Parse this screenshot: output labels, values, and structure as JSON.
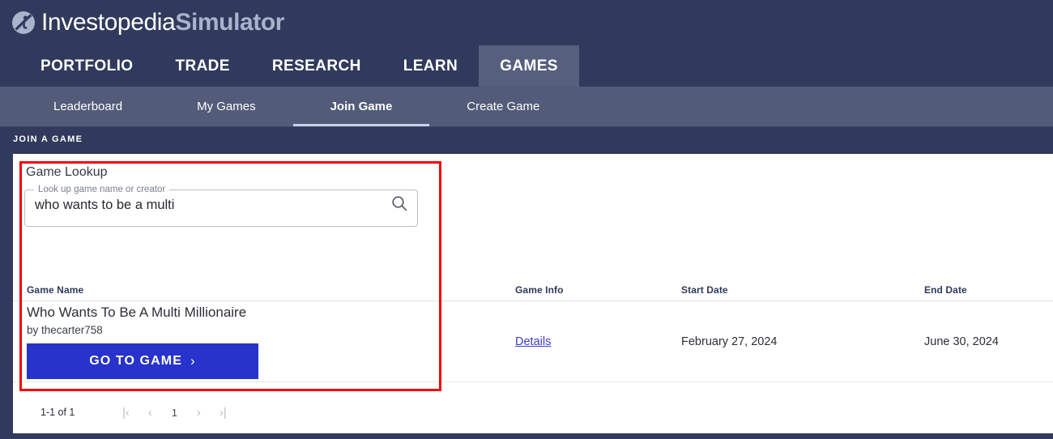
{
  "brand": {
    "logo_icon": "investopedia-circle-i-icon",
    "name_part1": "Investopedia",
    "name_part2": "Simulator"
  },
  "main_nav": {
    "items": [
      {
        "label": "PORTFOLIO",
        "active": false
      },
      {
        "label": "TRADE",
        "active": false
      },
      {
        "label": "RESEARCH",
        "active": false
      },
      {
        "label": "LEARN",
        "active": false
      },
      {
        "label": "GAMES",
        "active": true
      }
    ]
  },
  "sub_nav": {
    "items": [
      {
        "label": "Leaderboard",
        "active": false
      },
      {
        "label": "My Games",
        "active": false
      },
      {
        "label": "Join Game",
        "active": true
      },
      {
        "label": "Create Game",
        "active": false
      }
    ]
  },
  "section": {
    "title": "JOIN A GAME"
  },
  "lookup": {
    "card_heading": "Game Lookup",
    "field_legend": "Look up game name or creator",
    "input_value": "who wants to be a multi",
    "input_placeholder": "Look up game name or creator",
    "search_icon": "search-icon"
  },
  "table": {
    "headers": {
      "game_name": "Game Name",
      "game_info": "Game Info",
      "start_date": "Start Date",
      "end_date": "End Date"
    },
    "rows": [
      {
        "game_name": "Who Wants To Be A Multi Millionaire",
        "creator": "by thecarter758",
        "cta_label": "GO TO GAME",
        "cta_chevron": "›",
        "details_label": "Details",
        "start_date": "February 27, 2024",
        "end_date": "June 30, 2024"
      }
    ]
  },
  "pagination": {
    "range_text": "1-1 of 1",
    "first_label": "|‹",
    "prev_label": "‹",
    "current_page": "1",
    "next_label": "›",
    "last_label": "›|"
  },
  "colors": {
    "header_navy": "#303a5c",
    "nav_active_slate": "#565f7d",
    "subnav_slate": "#525b78",
    "subnav_underline": "#c7d3ea",
    "cta_blue": "#2833cc",
    "link_blue": "#3a3ad0",
    "annotation_red": "#fb0007",
    "panel_white": "#ffffff"
  },
  "annotation": {
    "shape": "rectangle",
    "target": "game-lookup-and-first-result"
  }
}
